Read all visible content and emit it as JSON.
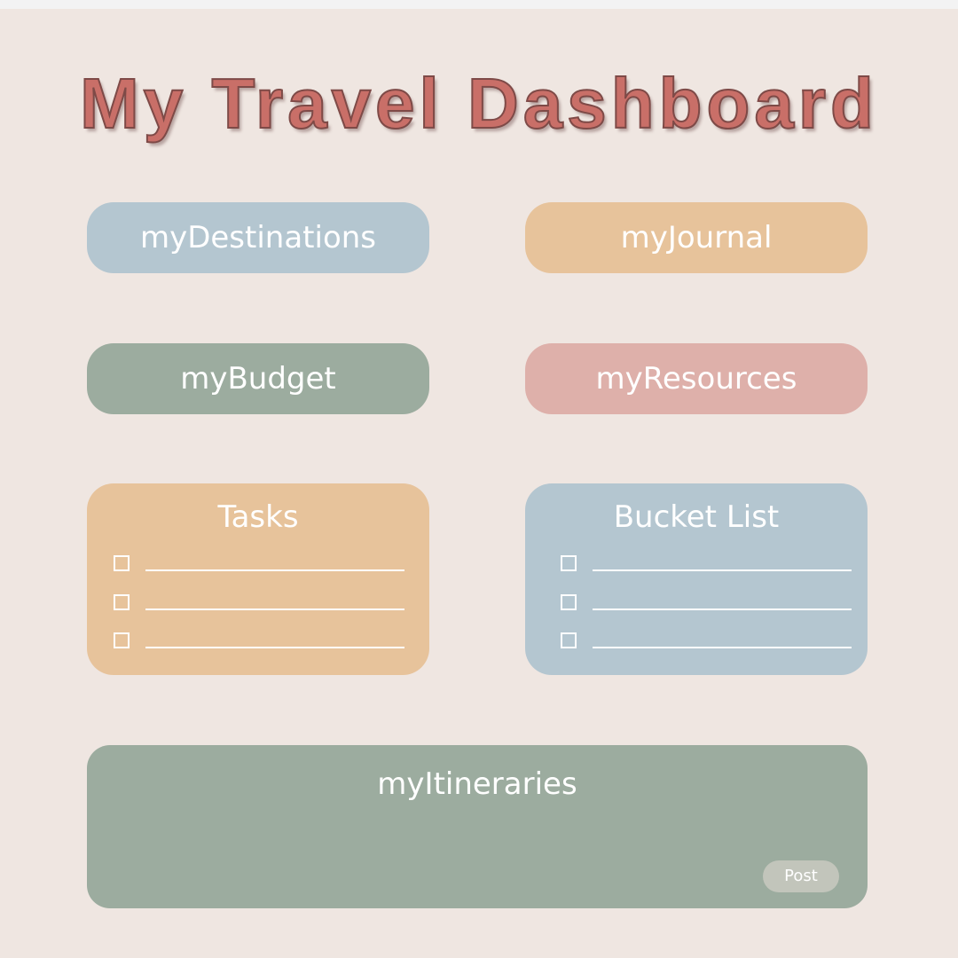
{
  "title": "My Travel Dashboard",
  "colors": {
    "background": "#efe6e1",
    "title": "#c96f68",
    "blue": "#b4c6d0",
    "tan": "#e7c39b",
    "sage": "#9cac9f",
    "rose": "#deb0aa"
  },
  "buttons": {
    "destinations": "myDestinations",
    "journal": "myJournal",
    "budget": "myBudget",
    "resources": "myResources"
  },
  "tasks": {
    "title": "Tasks",
    "items": [
      "",
      "",
      ""
    ]
  },
  "bucket_list": {
    "title": "Bucket List",
    "items": [
      "",
      "",
      ""
    ]
  },
  "itineraries": {
    "title": "myItineraries",
    "post_label": "Post"
  }
}
